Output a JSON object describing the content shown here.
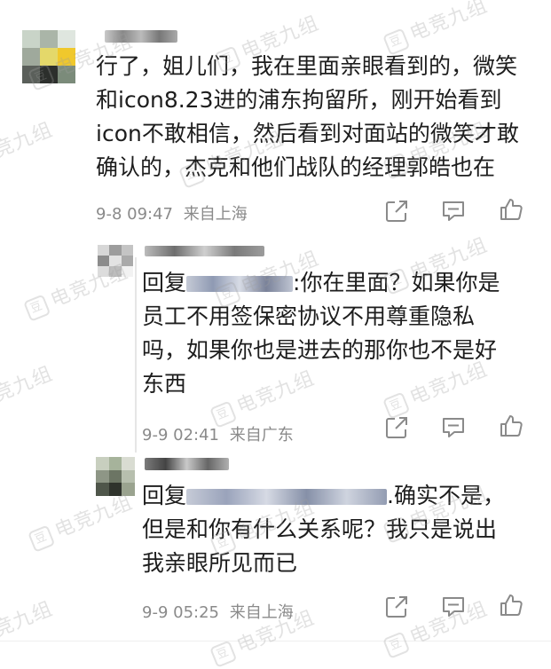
{
  "comments": [
    {
      "text": "行了，姐儿们，我在里面亲眼看到的，微笑和icon8.23进的浦东拘留所，刚开始看到icon不敢相信，然后看到对面站的微笑才敢确认的，杰克和他们战队的经理郭皓也在",
      "date": "9-8 09:47",
      "source": "来自上海"
    },
    {
      "reply_prefix": "回复",
      "text": ":你在里面？如果你是员工不用签保密协议不用尊重隐私吗，如果你也是进去的那你也不是好东西",
      "date": "9-9 02:41",
      "source": "来自广东"
    },
    {
      "reply_prefix": "回复",
      "text": ".确实不是，但是和你有什么关系呢？我只是说出我亲眼所见而已",
      "date": "9-9 05:25",
      "source": "来自上海"
    }
  ],
  "watermark": "电竞九组",
  "icons": [
    "share-icon",
    "comment-icon",
    "like-icon"
  ]
}
